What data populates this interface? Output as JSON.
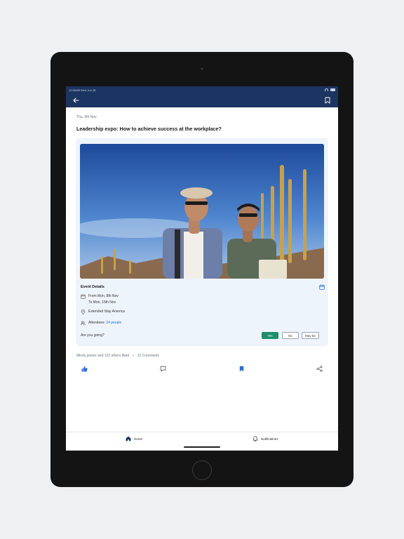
{
  "status_bar": {
    "time": "12:50AM Wed Jun 28"
  },
  "post": {
    "date": "Thu, 9th Nov",
    "title": "Leadership expo: How to achieve success at the workplace?"
  },
  "event": {
    "section_title": "Event Details",
    "from": "From Mon, 8th Nov",
    "to": "To Mon, 15th Nov",
    "location": "Extended Stay America",
    "attendees_label": "Attendees:",
    "attendees_count": "24 people",
    "rsvp_question": "Are you going?",
    "rsvp": {
      "yes": "Yes",
      "no": "No",
      "maybe": "May be"
    },
    "rsvp_selected": "Yes"
  },
  "engagement": {
    "likes": "Mindy jenner and 122 others liked",
    "separator": "•",
    "comments": "12 Comments"
  },
  "bottom_nav": {
    "home": "Home",
    "notifications": "Notifications"
  },
  "colors": {
    "app_bar": "#1c3461",
    "accent": "#2c6ed5",
    "yes_button": "#1e8f6e",
    "card_bg": "#eef4fb"
  },
  "icons": [
    "back-arrow-icon",
    "bookmark-icon",
    "calendar-icon",
    "location-pin-icon",
    "people-icon",
    "thumbs-up-icon",
    "comment-icon",
    "share-icon",
    "home-icon",
    "bell-icon"
  ]
}
